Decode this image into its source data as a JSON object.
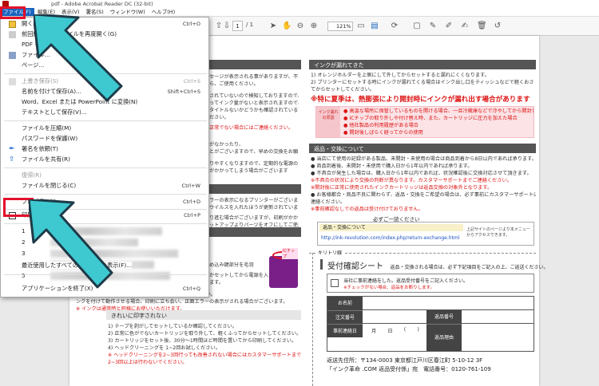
{
  "window": {
    "title": "pdf - Adobe Acrobat Reader DC (32-bit)"
  },
  "menubar": {
    "items": [
      "ファイル(F)",
      "編集(E)",
      "表示(V)",
      "署名(S)",
      "ウィンドウ(W)",
      "ヘルプ(H)"
    ]
  },
  "toolbar": {
    "page_current": "1",
    "page_total": "/ 1",
    "zoom": "121%"
  },
  "file_menu": {
    "items": [
      {
        "label": "開く...",
        "shortcut": "Ctrl+O",
        "disabled": false
      },
      {
        "label": "前回終了時のファイルを再度開く(G)",
        "shortcut": "",
        "disabled": false
      },
      {
        "label": "PDF を...",
        "shortcut": "",
        "disabled": false
      },
      {
        "label": "ファイル...",
        "shortcut": "",
        "disabled": false
      },
      {
        "label": "ページ...",
        "shortcut": "",
        "disabled": false
      },
      {
        "label": "上書き保存(S)",
        "shortcut": "Ctrl+S",
        "disabled": true
      },
      {
        "label": "名前を付けて保存(A)...",
        "shortcut": "Shift+Ctrl+S",
        "disabled": false
      },
      {
        "label": "Word、Excel または PowerPoint に変換(N)",
        "shortcut": "",
        "disabled": false
      },
      {
        "label": "テキストとして保存(V)...",
        "shortcut": "",
        "disabled": false
      },
      {
        "label": "ファイルを圧縮(M)",
        "shortcut": "",
        "disabled": false
      },
      {
        "label": "パスワードを保護(W)",
        "shortcut": "",
        "disabled": false
      },
      {
        "label": "署名を依頼(T)",
        "shortcut": "",
        "disabled": false
      },
      {
        "label": "ファイルを共有(R)",
        "shortcut": "",
        "disabled": false
      },
      {
        "label": "復帰(R)",
        "shortcut": "",
        "disabled": true
      },
      {
        "label": "ファイルを閉じる(C)",
        "shortcut": "Ctrl+W",
        "disabled": false
      },
      {
        "label": "プロパティ(I)...",
        "shortcut": "Ctrl+D",
        "disabled": false
      },
      {
        "label": "印刷(P)...",
        "shortcut": "Ctrl+P",
        "disabled": false
      },
      {
        "label": "最近使用したすべてのファイルを表示(F)...",
        "shortcut": "",
        "disabled": false
      },
      {
        "label": "アプリケーションを終了(X)",
        "shortcut": "Ctrl+Q",
        "disabled": false
      }
    ],
    "recent_numbers": [
      "1",
      "2",
      "3",
      "4",
      "5"
    ]
  },
  "document": {
    "right_col": {
      "ink_header": "インクが漏れてきた",
      "ink_lines": [
        "1) オレンジホルダーを上側にして外してからセットすると漏れにくくなります。",
        "2) プリンターにセットする時にインクが漏れてくる場合はインク出し口をティッシュなどで軽くおさえ",
        "   てからセットしてください。"
      ],
      "summer_warning": "※特に夏季は、熱膨張により開封時にインクが漏れ出す場合があります",
      "pink_lines": [
        "● 高温な場所に保管しているものを開ける場合、一旦冷蔵庫などで冷やしてから開封してください",
        "● ICチップの取り外しや付け替え時、また、カートリッジに圧力を加えた場合",
        "● 他社製品の利用履歴がある場合",
        "● 開封後しばらく経ってからの使用"
      ],
      "pink_side_label": "インク漏れの原因",
      "return_header": "返品・交換について",
      "return_lines": [
        "● 当店にて使用の記録がある製品、未開封・未使用の場合は商品到着から8日以内であれば承ります。",
        "● 商品到着後、未開封・未使用で購入日から1年以内であれば承ります。",
        "● 不具合が発生した場合は、購入日から1年以内であれば、状況確認後に交換対応させて頂きます。",
        "   ※不具合の状況により交換の判断が異なります。カスタマーサポートまでご連絡ください。",
        "   ※開封後に正常に使用されたインクカートリッジは返品交換の対象外となります。",
        "● お客様都合・商品不良に関わらず、返品・交換をご希望の場合は、必ず事前にカスタマーサポートにご",
        "   連絡ください。",
        "   ※事前確認なしでの返品は受け付けておりません。"
      ],
      "confirm_label": "必ずご一読ください",
      "return_box_title": "返品・交換について",
      "return_url": "http://ink-revolution.com/index.php/return-exchange.html",
      "return_side_note": "上記サイトのページより本メニューからアクセスできます。",
      "cut_line": "キリトリ線",
      "receipt_title": "受付確認シート",
      "receipt_subtitle": "返品・交換される場合は、必ず下記項目をご記入の上、ご返送ください。",
      "receipt_check": "当社に事前連絡をした。返品受付番号をご記入ください。",
      "receipt_check_note": "※チェックがない場合、返品をお断りします。",
      "form_labels": [
        "お名前",
        "注文番号",
        "返品番号",
        "返品理由"
      ],
      "form_date_label": "事前連絡日",
      "form_date_parts": [
        "月",
        "日",
        "(",
        ")"
      ],
      "address_line1": "返送先住所：〒134-0003 東京都江戸川区春江町 5-10-12 3F",
      "address_line2": "「インク革命 .COM 返品受付係」宛　電話番号：0120-761-109"
    },
    "left_col": {
      "snippets": [
        "セージが表示される事がありますが、不良で",
        "ら、ご使用ください。",
        "されていないので検知しておりますので、カートリッジ内",
        "ってインク量がないと表示されますので、検知表示",
        "タイトルないかどうかも確認されている可能性もあるので",
        "ださい。",
        "正常でない場合にはご連絡ください。",
        "がなかったり、",
        "とがございますので、早めの交換をお願",
        "りやすくなりますので、定期的な電源の",
        "がかかってしまう場合がございます",
        "ラーの表示になるプリンターがございます。",
        "ウイルスを入れたほうが更新されています。",
        "り進む場合がございますが、印刷がかかる場合はそ",
        "ットアップよりパーツをオフにしてご使用頂く必要がございます。",
        "ボタンを5秒以上長押しして頂く事で、機能解除が可能"
      ],
      "middle_snippets": [
        "め込み鍵部分を毛羽",
        "かセットしてから電源を入",
        "ます。",
        "(前面排紙などが付いている場合は、機能を解除してください。",
        "ンクを付けて動作させる場合、印刷に立ち会い、正面エラーの表示がされる場合がございます。",
        "※ インクは通常時と同様にお使いいただけます。"
      ],
      "clean_header": "きれいに印字されない",
      "clean_lines": [
        "1) テープを剥がしてセットしているか確認してください。",
        "2) 正常に色がでないカートリッジを取り外して、軽くふってからセットしてください。",
        "3) カートリッジをセット後、30分～1時間ほど時間を置いてから印刷してください。",
        "4) ヘッドクリーニングを 1~2回お試しください。",
        "   ※ ヘッドクリーニングを2~3回行っても改善されない場合にはカスタマーサポートまでご連絡ください。",
        "   2~3回以上は行わないでください。"
      ],
      "tag_label": "ICチップ"
    }
  },
  "colors": {
    "menu_highlight": "#1a65c0",
    "annotation_red": "#e3102a",
    "arrow_teal": "#3ec8d0",
    "warning_red": "#dd1111",
    "header_gray": "#555555"
  }
}
